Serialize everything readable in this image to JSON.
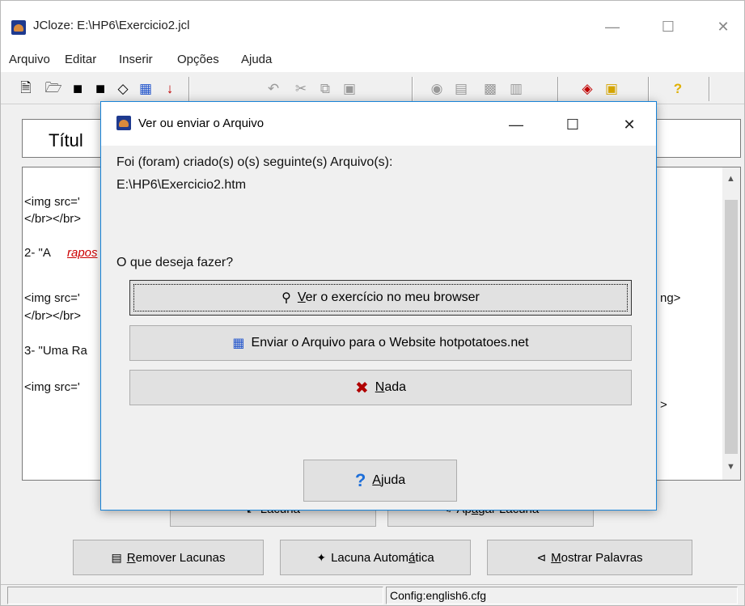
{
  "main": {
    "title": "JCloze: E:\\HP6\\Exercicio2.jcl",
    "caption": {
      "minimize": "—",
      "maximize": "☐",
      "close": "✕"
    },
    "menu": [
      "Arquivo",
      "Editar",
      "Inserir",
      "Opções",
      "Ajuda"
    ],
    "title_field": "Títul",
    "editor_lines": [
      "<img src='",
      "</br></br>",
      "2- \"A ",
      "rapos",
      "<img src='",
      "</br></br>",
      "3- \"Uma Ra",
      "<img src='",
      "ng>",
      ">"
    ],
    "buttons": {
      "gap": "Lacuna",
      "delete_gap_a": "Ap",
      "delete_gap_u": "a",
      "delete_gap_b": "gar Lacuna",
      "remove_gaps_u": "R",
      "remove_gaps": "emover Lacunas",
      "auto_gap_a": "Lacuna Autom",
      "auto_gap_u": "á",
      "auto_gap_b": "tica",
      "show_words_u": "M",
      "show_words": "ostrar Palavras"
    },
    "status": "Config:english6.cfg"
  },
  "dialog": {
    "title": "Ver ou enviar o Arquivo",
    "caption": {
      "minimize": "—",
      "maximize": "☐",
      "close": "✕"
    },
    "created_msg": "Foi (foram) criado(s) o(s) seguinte(s) Arquivo(s):",
    "file_path": "E:\\HP6\\Exercicio2.htm",
    "question": "O que deseja fazer?",
    "view_u": "V",
    "view_rest": "er o exercício no meu browser",
    "upload": "Enviar o Arquivo para o Website hotpotatoes.net",
    "none_u": "N",
    "none_rest": "ada",
    "help_u": "A",
    "help_rest": "juda"
  },
  "colors": {
    "accent": "#1883d7",
    "gap_text": "#cc0000",
    "help": "#1e6fd9",
    "nada": "#b00000"
  }
}
